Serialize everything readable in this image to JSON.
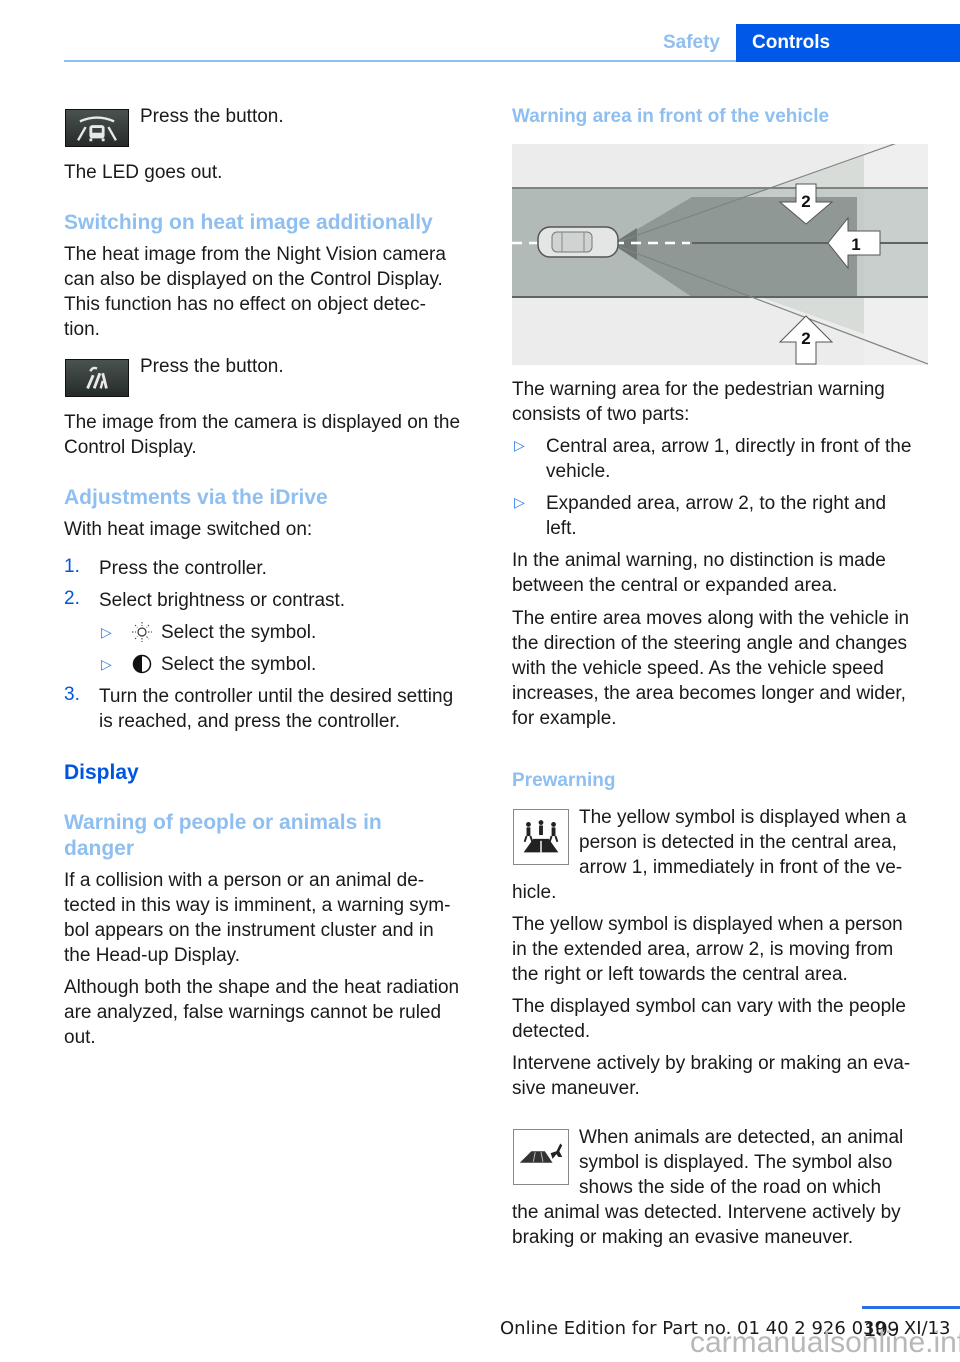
{
  "header": {
    "section": "Safety",
    "chapter": "Controls"
  },
  "left": {
    "press_button_1": "Press the button.",
    "led_out": "The LED goes out.",
    "heat_heading": "Switching on heat image additionally",
    "heat_lines": [
      "The heat image from the Night Vision camera",
      "can also be displayed on the Control Display.",
      "This function has no effect on object detec-",
      "tion."
    ],
    "press_button_2": "Press the button.",
    "camera_lines": [
      "The image from the camera is displayed on the",
      "Control Display."
    ],
    "idrive_heading": "Adjustments via the iDrive",
    "idrive_intro": "With heat image switched on:",
    "steps": [
      {
        "num": "1.",
        "text": "Press the controller."
      },
      {
        "num": "2.",
        "text": "Select brightness or contrast."
      },
      {
        "num": "3.",
        "text": "Turn the controller until the desired setting",
        "text2": "is reached, and press the controller."
      }
    ],
    "substeps": [
      {
        "icon": "brightness-icon",
        "text": "Select the symbol."
      },
      {
        "icon": "contrast-icon",
        "text": "Select the symbol."
      }
    ],
    "display_heading": "Display",
    "warning_heading_1": "Warning of people or animals in",
    "warning_heading_2": "danger",
    "warning_lines": [
      "If a collision with a person or an animal de-",
      "tected in this way is imminent, a warning sym-",
      "bol appears on the instrument cluster and in",
      "the Head-up Display."
    ],
    "analysis_lines": [
      "Although both the shape and the heat radiation",
      "are analyzed, false warnings cannot be ruled",
      "out."
    ]
  },
  "right": {
    "area_heading": "Warning area in front of the vehicle",
    "diagram_labels": {
      "arrow_top": "2",
      "arrow_center": "1",
      "arrow_bottom": "2"
    },
    "area_intro_lines": [
      "The warning area for the pedestrian warning",
      "consists of two parts:"
    ],
    "bullets": [
      {
        "line1": "Central area, arrow 1, directly in front of the",
        "line2": "vehicle."
      },
      {
        "line1": "Expanded area, arrow 2, to the right and",
        "line2": "left."
      }
    ],
    "animal_lines": [
      "In the animal warning, no distinction is made",
      "between the central or expanded area."
    ],
    "moves_lines": [
      "The entire area moves along with the vehicle in",
      "the direction of the steering angle and changes",
      "with the vehicle speed. As the vehicle speed",
      "increases, the area becomes longer and wider,",
      "for example."
    ],
    "prewarning_heading": "Prewarning",
    "yellow_lines_1": [
      "The yellow symbol is displayed when a",
      "person is detected in the central area,",
      "arrow 1, immediately in front of the ve-",
      "hicle."
    ],
    "yellow_lines_2": [
      "The yellow symbol is displayed when a person",
      "in the extended area, arrow 2, is moving from",
      "the right or left towards the central area."
    ],
    "vary_lines": [
      "The displayed symbol can vary with the people",
      "detected."
    ],
    "intervene_lines": [
      "Intervene actively by braking or making an eva-",
      "sive maneuver."
    ],
    "animal_symbol_lines": [
      "When animals are detected, an animal",
      "symbol is displayed. The symbol also",
      "shows the side of the road on which",
      "the animal was detected. Intervene actively by",
      "braking or making an evasive maneuver."
    ]
  },
  "footer": {
    "edition": "Online Edition for Part no. 01 40 2 926 039 - XI/13",
    "page": "109",
    "watermark": "carmanualsonline.info"
  }
}
